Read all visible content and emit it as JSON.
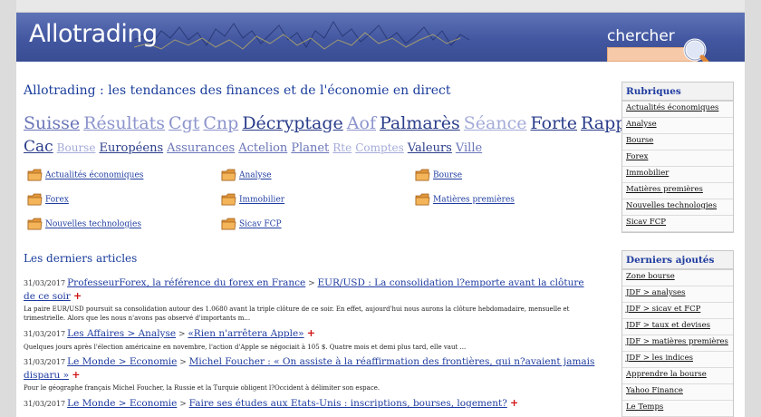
{
  "header": {
    "logo": "Allotrading",
    "search_label": "chercher"
  },
  "headline": "Allotrading : les tendances des finances et de l'économie en direct",
  "tags": [
    {
      "label": "Suisse",
      "size": 19,
      "color": "#6a75b8"
    },
    {
      "label": "Résultats",
      "size": 19,
      "color": "#8c94cc"
    },
    {
      "label": "Cgt",
      "size": 19,
      "color": "#8c94cc"
    },
    {
      "label": "Cnp",
      "size": 19,
      "color": "#8c94cc"
    },
    {
      "label": "Décryptage",
      "size": 19,
      "color": "#2a3d8a"
    },
    {
      "label": "Aof",
      "size": 19,
      "color": "#8c94cc"
    },
    {
      "label": "Palmarès",
      "size": 19,
      "color": "#2a3d8a"
    },
    {
      "label": "Séance",
      "size": 19,
      "color": "#a4abd8"
    },
    {
      "label": "Forte",
      "size": 19,
      "color": "#2a3d8a"
    },
    {
      "label": "Rapport",
      "size": 19,
      "color": "#2a3d8a"
    },
    {
      "label": "Cac",
      "size": 17,
      "color": "#2a3d8a"
    },
    {
      "label": "Bourse",
      "size": 12,
      "color": "#a4abd8"
    },
    {
      "label": "Européens",
      "size": 13,
      "color": "#2a3d8a"
    },
    {
      "label": "Assurances",
      "size": 13,
      "color": "#6a75b8"
    },
    {
      "label": "Actelion",
      "size": 13,
      "color": "#6a75b8"
    },
    {
      "label": "Planet",
      "size": 13,
      "color": "#6a75b8"
    },
    {
      "label": "Rte",
      "size": 12,
      "color": "#a4abd8"
    },
    {
      "label": "Comptes",
      "size": 12,
      "color": "#a4abd8"
    },
    {
      "label": "Valeurs",
      "size": 13,
      "color": "#2a3d8a"
    },
    {
      "label": "Ville",
      "size": 13,
      "color": "#6a75b8"
    }
  ],
  "categories": [
    "Actualités économiques",
    "Analyse",
    "Bourse",
    "Forex",
    "Immobilier",
    "Matières premières",
    "Nouvelles technologies",
    "Sicav FCP"
  ],
  "section_title": "Les derniers articles",
  "articles": [
    {
      "date": "31/03/2017",
      "source": "ProfesseurForex, la référence du forex en France",
      "title": "EUR/USD : La consolidation l?emporte avant la clôture de ce soir",
      "excerpt": "La paire EUR/USD poursuit sa consolidation autour des 1.0680 avant la triple clôture de ce soir. En effet, aujourd'hui nous aurons la clôture hebdomadaire, mensuelle et trimestrielle. Alors que les nous n'avons pas observé d'importants m..."
    },
    {
      "date": "31/03/2017",
      "source": "Les Affaires > Analyse",
      "title": "«Rien n'arrêtera Apple»",
      "excerpt": "Quelques jours après l'élection américaine en novembre, l'action d'Apple se négociait à 105 $. Quatre mois et demi plus tard, elle vaut ..."
    },
    {
      "date": "31/03/2017",
      "source": "Le Monde > Economie",
      "title": "Michel Foucher : « On assiste à la réaffirmation des frontières, qui n?avaient jamais disparu »",
      "excerpt": "Pour le géographe français Michel Foucher, la Russie et la Turquie obligent l?Occident à délimiter son espace."
    },
    {
      "date": "31/03/2017",
      "source": "Le Monde > Economie",
      "title": "Faire ses études aux Etats-Unis : inscriptions, bourses, logement?",
      "excerpt": ""
    }
  ],
  "sidebar_rubriques": {
    "title": "Rubriques",
    "items": [
      "Actualités économiques",
      "Analyse",
      "Bourse",
      "Forex",
      "Immobilier",
      "Matières premières",
      "Nouvelles technologies",
      "Sicav FCP"
    ]
  },
  "sidebar_derniers": {
    "title": "Derniers ajoutés",
    "items": [
      "Zone bourse",
      "JDF > analyses",
      "JDF > sicav et FCP",
      "JDF > taux et devises",
      "JDF > matières premières",
      "JDF > les indices",
      "Apprendre la bourse",
      "Yahoo Finance",
      "Le Temps"
    ]
  },
  "colors": {
    "header_blue": "#4257a0",
    "link_blue": "#1f3ca0",
    "plus_red": "#d01010",
    "search_orange": "#f6c9a8"
  }
}
